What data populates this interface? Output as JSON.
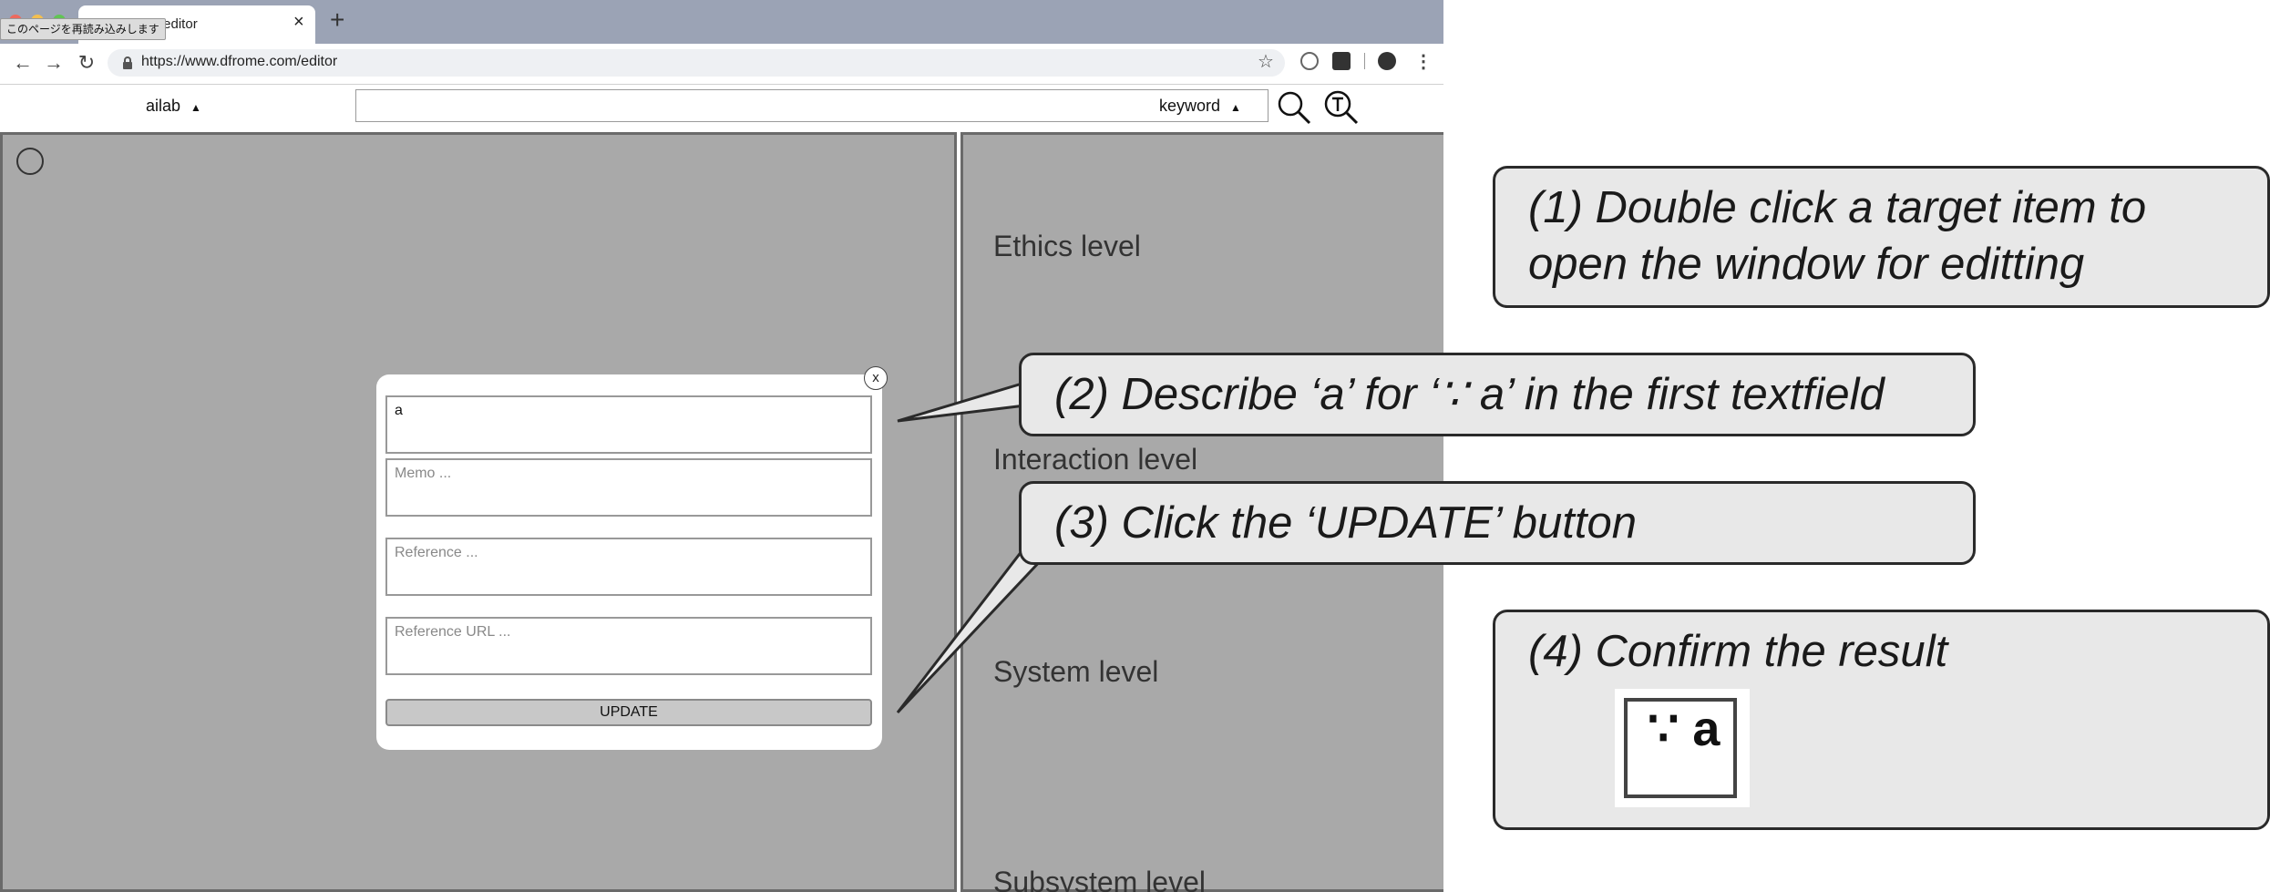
{
  "browser": {
    "tab_title": "- editor",
    "tab_close": "×",
    "new_tab": "+",
    "tooltip": "このページを再読み込みします",
    "url": "https://www.dfrome.com/editor",
    "nav": {
      "back": "←",
      "forward": "→",
      "reload": "↻"
    }
  },
  "header": {
    "user": "ailab",
    "user_caret": "▲",
    "search": {
      "value": ""
    },
    "search_mode": "keyword",
    "search_mode_caret": "▲"
  },
  "levels": [
    "Ethics level",
    "Interaction level",
    "System level",
    "Subsystem level"
  ],
  "modal": {
    "close": "x",
    "fields": [
      {
        "value": "a",
        "placeholder": ""
      },
      {
        "value": "",
        "placeholder": "Memo ..."
      },
      {
        "value": "",
        "placeholder": "Reference ..."
      },
      {
        "value": "",
        "placeholder": "Reference URL ..."
      }
    ],
    "update_label": "UPDATE"
  },
  "callouts": {
    "step1": "(1) Double click a target item to open the window for editting",
    "step2": "(2) Describe ‘a’ for ‘∵ a’ in the first textfield",
    "step3": "(3) Click the ‘UPDATE’ button",
    "step4": "(4) Confirm the result",
    "result": "∵ a"
  },
  "colors": {
    "panel_bg": "#a9a9a9",
    "panel_border": "#6a6a6a",
    "tabstrip": "#9ba3b5",
    "callout_bg": "#e8e8e8"
  }
}
